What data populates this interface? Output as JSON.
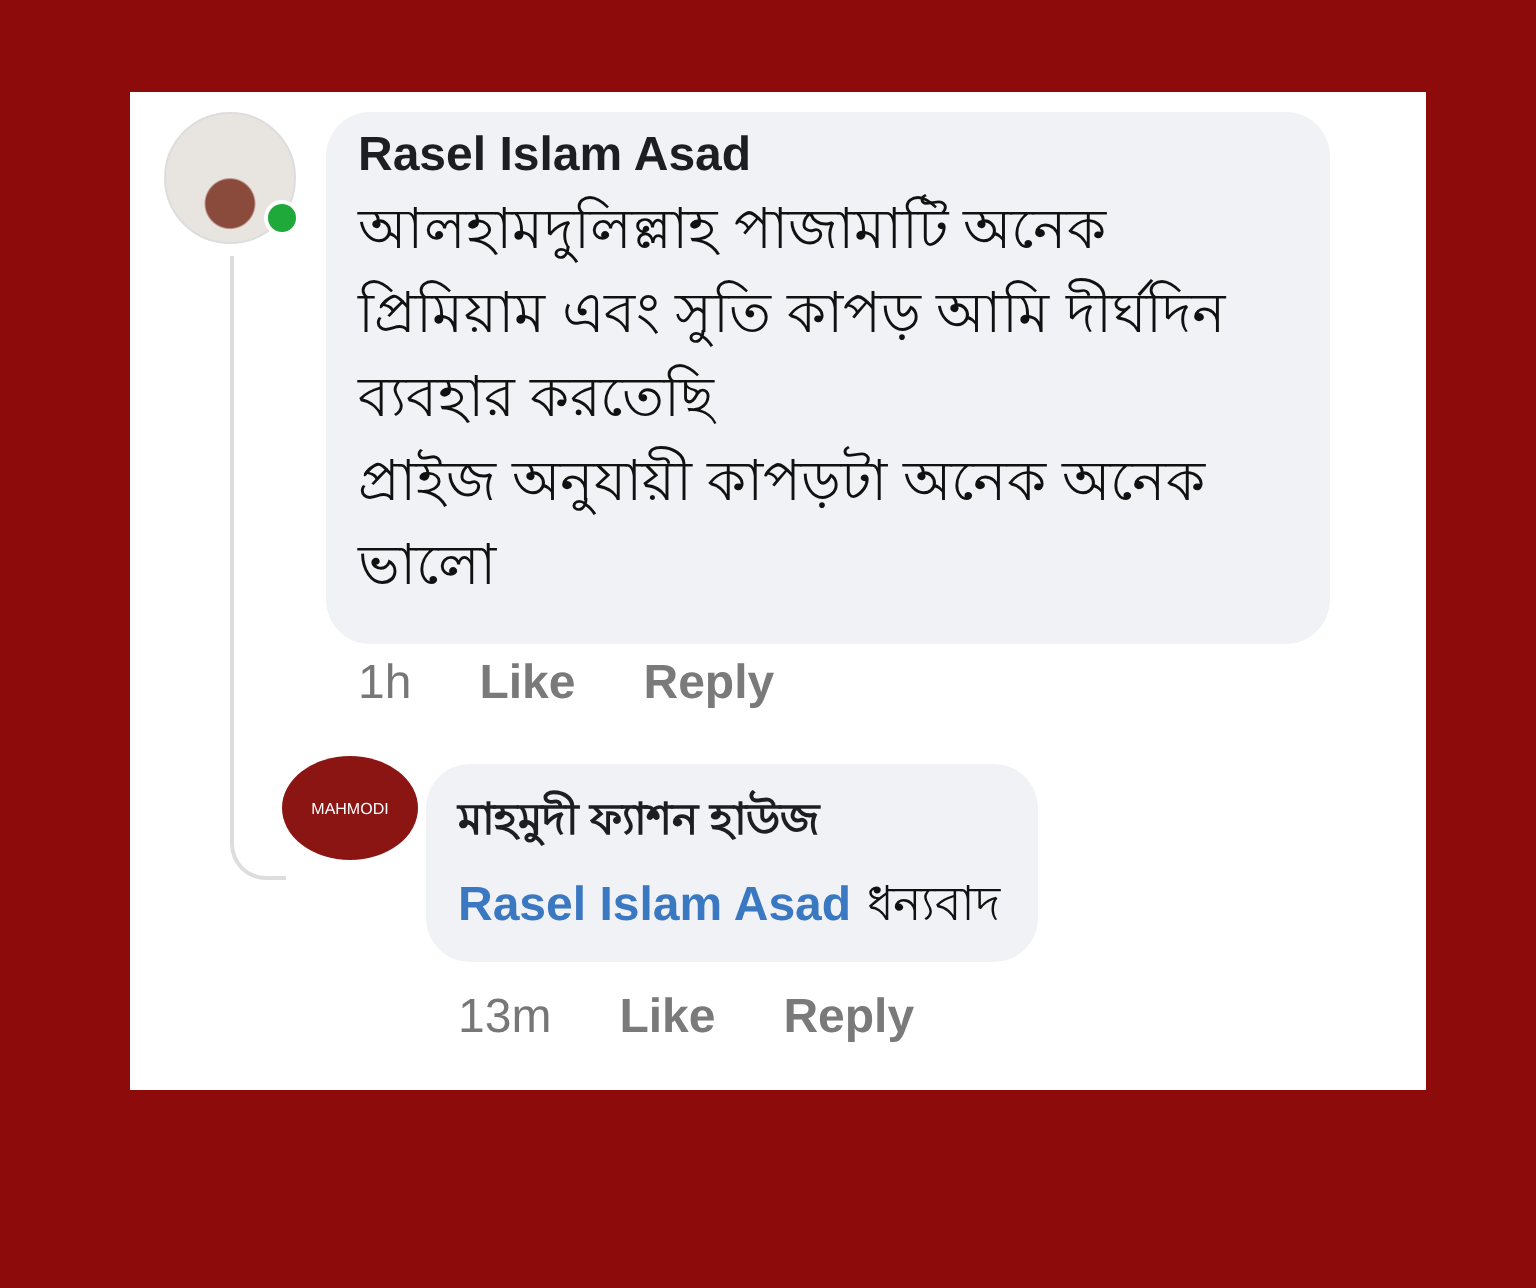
{
  "comments": [
    {
      "author": "Rasel Islam Asad",
      "online": true,
      "avatar": {
        "kind": "photo"
      },
      "text_lines": [
        {
          "parts": [
            {
              "kind": "text",
              "text": "আলহামদুলিল্লাহ পাজামাটি অনেক"
            }
          ]
        },
        {
          "parts": [
            {
              "kind": "text",
              "text": "প্রিমিয়াম এবং সুতি কাপড় আমি দীর্ঘদিন"
            }
          ]
        },
        {
          "parts": [
            {
              "kind": "text",
              "text": "ব্যবহার করতেছি"
            }
          ]
        },
        {
          "parts": [
            {
              "kind": "text",
              "text": "প্রাইজ অনুযায়ী কাপড়টা অনেক অনেক"
            }
          ]
        },
        {
          "parts": [
            {
              "kind": "text",
              "text": "ভালো"
            }
          ]
        }
      ],
      "time": "1h",
      "actions": [
        "Like",
        "Reply"
      ],
      "replies": [
        {
          "author": "মাহমুদী ফ্যাশন হাউজ",
          "avatar": {
            "kind": "logo",
            "logo_text": "MAHMODI"
          },
          "text_lines": [
            {
              "parts": [
                {
                  "kind": "mention",
                  "text": "Rasel Islam Asad"
                },
                {
                  "kind": "text",
                  "text": "ধন্যবাদ"
                }
              ]
            }
          ],
          "time": "13m",
          "actions": [
            "Like",
            "Reply"
          ]
        }
      ]
    }
  ]
}
